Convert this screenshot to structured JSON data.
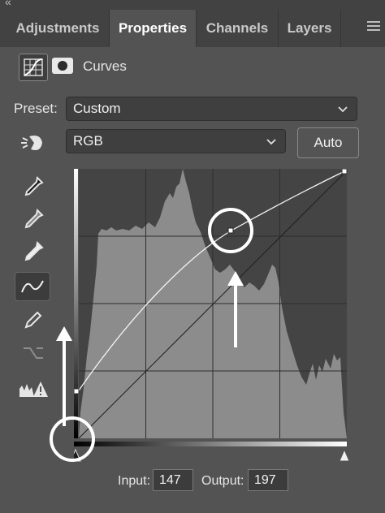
{
  "tabs": [
    {
      "label": "Adjustments",
      "active": false
    },
    {
      "label": "Properties",
      "active": true
    },
    {
      "label": "Channels",
      "active": false
    },
    {
      "label": "Layers",
      "active": false
    }
  ],
  "panel": {
    "title": "Curves"
  },
  "preset": {
    "label": "Preset:",
    "value": "Custom"
  },
  "channel": {
    "value": "RGB"
  },
  "auto_label": "Auto",
  "io": {
    "input_label": "Input:",
    "input_value": "147",
    "output_label": "Output:",
    "output_value": "197"
  },
  "tools": [
    "targeted-adjustment-icon",
    "black-point-eyedropper-icon",
    "gray-point-eyedropper-icon",
    "white-point-eyedropper-icon",
    "curve-points-icon",
    "pencil-icon",
    "smooth-curve-icon",
    "clipping-warning-icon"
  ],
  "colors": {
    "panel_bg": "#535353",
    "tab_bar_bg": "#424242",
    "graph_bg": "#444444",
    "histogram": "#8c8c8c"
  }
}
